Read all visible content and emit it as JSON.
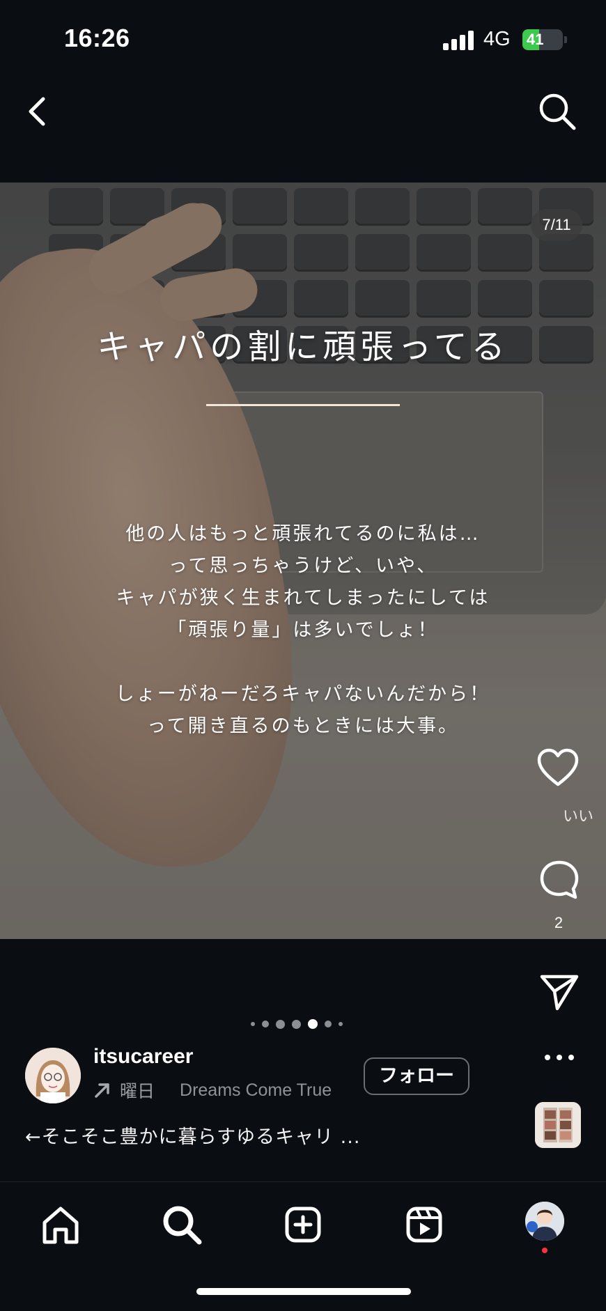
{
  "status_bar": {
    "time": "16:26",
    "network": "4G",
    "battery_level": "41",
    "battery_fill_fraction": 0.41,
    "battery_color": "#3cc94e"
  },
  "header": {
    "back_icon": "chevron-left-icon",
    "search_icon": "search-icon"
  },
  "post": {
    "page_counter": "7/11",
    "title": "キャパの割に頑張ってる",
    "body_lines": [
      "他の人はもっと頑張れてるのに私は…",
      "って思っちゃうけど、いや、",
      "キャパが狭く生まれてしまったにしては",
      "「頑張り量」は多いでしょ！",
      "",
      "しょーがねーだろキャパないんだから！",
      "って開き直るのもときには大事。"
    ],
    "active_dot_index": 4,
    "total_dots": 7
  },
  "actions": {
    "like_icon": "heart-icon",
    "like_label": "いい",
    "comment_icon": "comment-icon",
    "comment_count": "2",
    "share_icon": "send-icon",
    "more_icon": "more-icon"
  },
  "account": {
    "username": "itsucareer",
    "music_day": "曜日",
    "music_title": "Dreams Come True",
    "follow_label": "フォロー",
    "caption": "←そこそこ豊かに暮らすゆるキャリ ..."
  },
  "bottom_nav": {
    "items": [
      "home-icon",
      "search-icon",
      "create-icon",
      "reels-icon",
      "profile-avatar"
    ]
  }
}
